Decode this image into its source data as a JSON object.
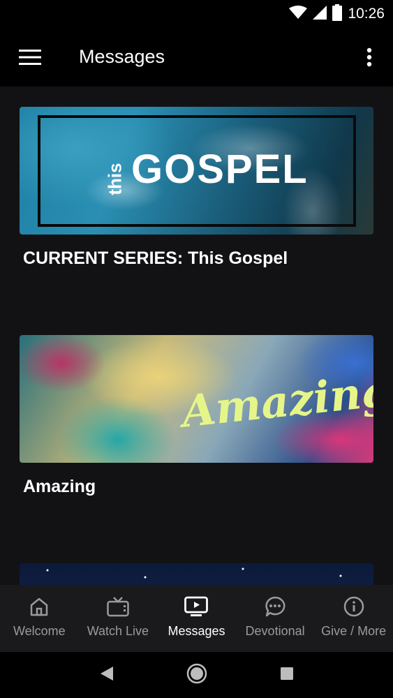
{
  "status_bar": {
    "time": "10:26",
    "icons": [
      "wifi-icon",
      "cellular-signal-icon",
      "battery-icon"
    ]
  },
  "app_bar": {
    "title": "Messages",
    "menu_icon": "hamburger-menu-icon",
    "overflow_icon": "more-vert-icon"
  },
  "messages": [
    {
      "title": "CURRENT SERIES:  This Gospel",
      "art_text_small": "this",
      "art_text_large": "GOSPEL"
    },
    {
      "title": "Amazing",
      "art_text": "Amazing"
    },
    {
      "title": ""
    }
  ],
  "bottom_nav": {
    "items": [
      {
        "label": "Welcome",
        "icon": "home-icon",
        "active": false
      },
      {
        "label": "Watch Live",
        "icon": "tv-icon",
        "active": false
      },
      {
        "label": "Messages",
        "icon": "play-screen-icon",
        "active": true
      },
      {
        "label": "Devotional",
        "icon": "chat-bubble-icon",
        "active": false
      },
      {
        "label": "Give / More",
        "icon": "info-icon",
        "active": false
      }
    ]
  },
  "system_nav": [
    "back-icon",
    "home-circle-icon",
    "recents-icon"
  ]
}
